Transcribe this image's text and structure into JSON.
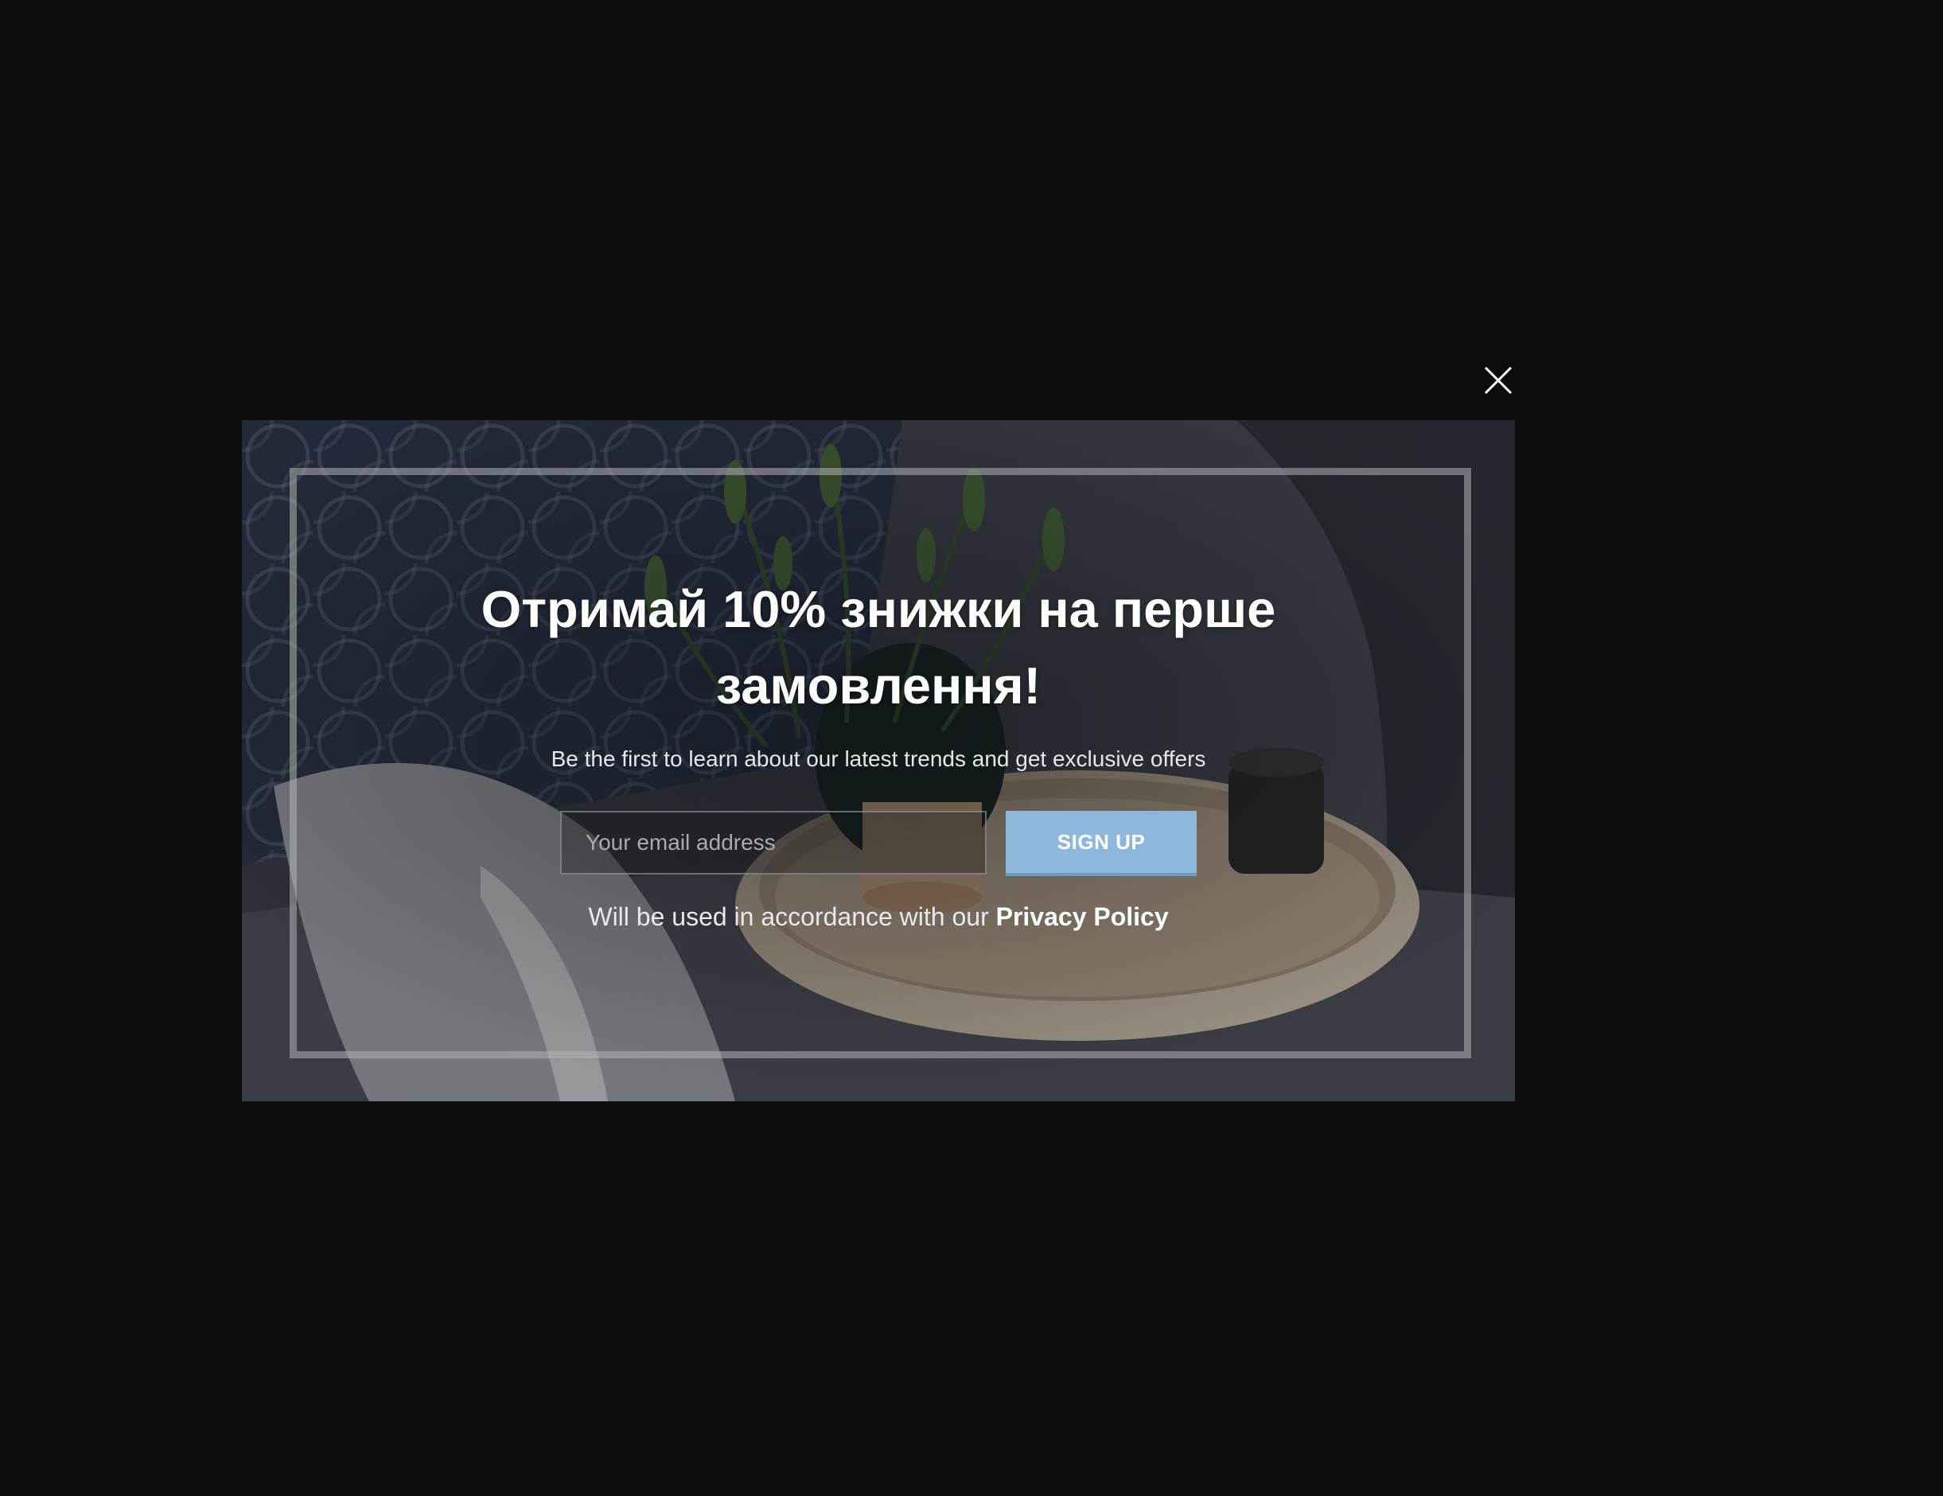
{
  "popup": {
    "headline": "Отримай 10% знижки на перше замовлення!",
    "subtitle": "Be the first to learn about our latest trends and get exclusive offers",
    "email_placeholder": "Your email address",
    "signup_label": "SIGN UP",
    "policy_text": "Will be used in accordance with our ",
    "policy_link": "Privacy Policy"
  },
  "colors": {
    "page_background": "#0c0c0d",
    "signup_button": "#8db8dc",
    "text": "#ffffff"
  },
  "icons": {
    "close": "close-icon"
  }
}
